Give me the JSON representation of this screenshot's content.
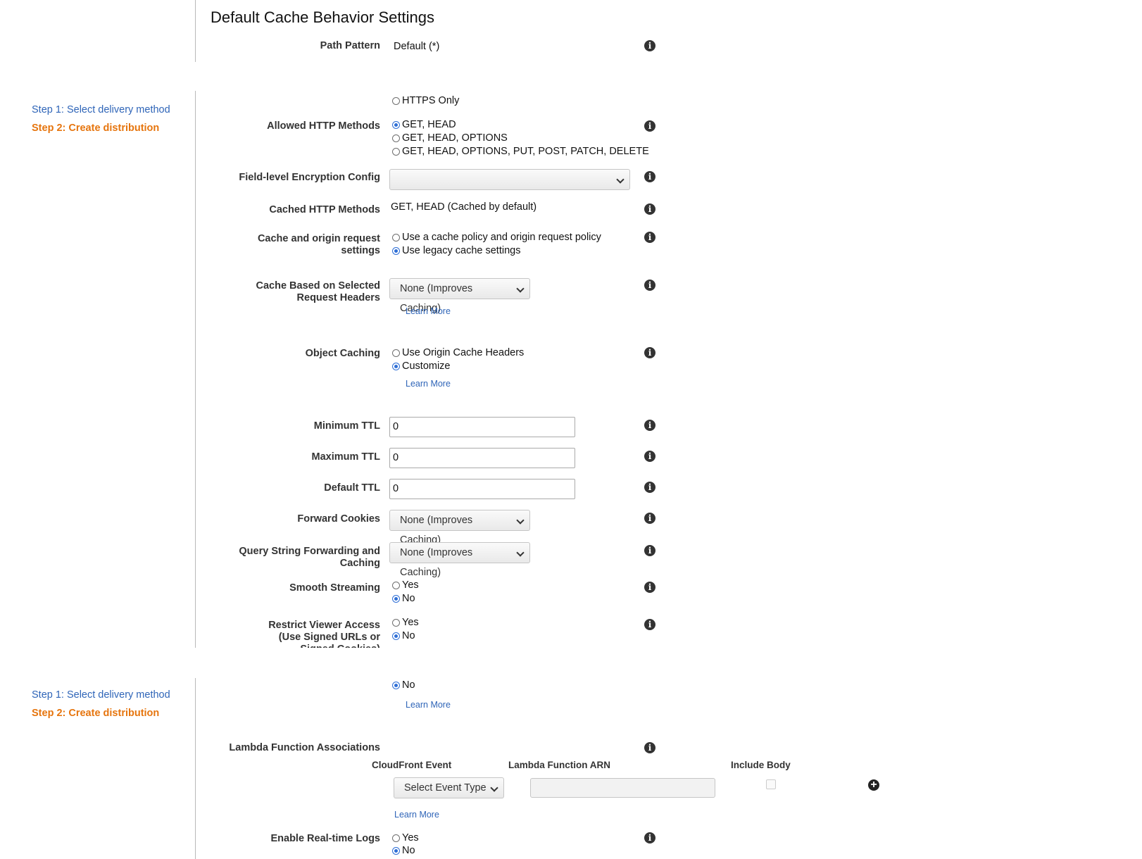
{
  "header": {
    "title": "Default Cache Behavior Settings"
  },
  "wizard": {
    "step1": "Step 1: Select delivery method",
    "step2": "Step 2: Create distribution"
  },
  "fields": {
    "path_pattern": {
      "label": "Path Pattern",
      "value": "Default (*)"
    },
    "viewer_protocol": {
      "options": [
        "HTTPS Only"
      ]
    },
    "allowed_methods": {
      "label": "Allowed HTTP Methods",
      "options": [
        "GET, HEAD",
        "GET, HEAD, OPTIONS",
        "GET, HEAD, OPTIONS, PUT, POST, PATCH, DELETE"
      ],
      "selected": "GET, HEAD"
    },
    "fle_config": {
      "label": "Field-level Encryption Config",
      "value": ""
    },
    "cached_methods": {
      "label": "Cached HTTP Methods",
      "value": "GET, HEAD (Cached by default)"
    },
    "cache_origin_settings": {
      "label_1": "Cache and origin request",
      "label_2": "settings",
      "options": [
        "Use a cache policy and origin request policy",
        "Use legacy cache settings"
      ],
      "selected": "Use legacy cache settings"
    },
    "cache_headers": {
      "label_1": "Cache Based on Selected",
      "label_2": "Request Headers",
      "value": "None (Improves Caching)",
      "learn_more": "Learn More"
    },
    "object_caching": {
      "label": "Object Caching",
      "options": [
        "Use Origin Cache Headers",
        "Customize"
      ],
      "selected": "Customize",
      "learn_more": "Learn More"
    },
    "min_ttl": {
      "label": "Minimum TTL",
      "value": "0"
    },
    "max_ttl": {
      "label": "Maximum TTL",
      "value": "0"
    },
    "default_ttl": {
      "label": "Default TTL",
      "value": "0"
    },
    "forward_cookies": {
      "label": "Forward Cookies",
      "value": "None (Improves Caching)"
    },
    "query_string": {
      "label_1": "Query String Forwarding and",
      "label_2": "Caching",
      "value": "None (Improves Caching)"
    },
    "smooth_streaming": {
      "label": "Smooth Streaming",
      "options": [
        "Yes",
        "No"
      ],
      "selected": "No"
    },
    "restrict_viewer": {
      "label_1": "Restrict Viewer Access",
      "label_2": "(Use Signed URLs or",
      "label_3": "Signed Cookies)",
      "options": [
        "Yes",
        "No"
      ],
      "selected": "No"
    },
    "compress": {
      "options": [
        "No"
      ],
      "selected": "No",
      "learn_more": "Learn More"
    },
    "lambda": {
      "label": "Lambda Function Associations",
      "col_event": "CloudFront Event",
      "col_arn": "Lambda Function ARN",
      "col_body": "Include Body",
      "event_value": "Select Event Type",
      "arn_value": "",
      "learn_more": "Learn More"
    },
    "realtime_logs": {
      "label": "Enable Real-time Logs",
      "options": [
        "Yes",
        "No"
      ],
      "selected": "No"
    }
  },
  "icons": {
    "info": "info-icon",
    "add": "plus-circle-icon",
    "chevron": "chevron-down-icon"
  },
  "colors": {
    "link": "#2f65b8",
    "active_step": "#e6750e",
    "radio": "#2f6fd6"
  }
}
